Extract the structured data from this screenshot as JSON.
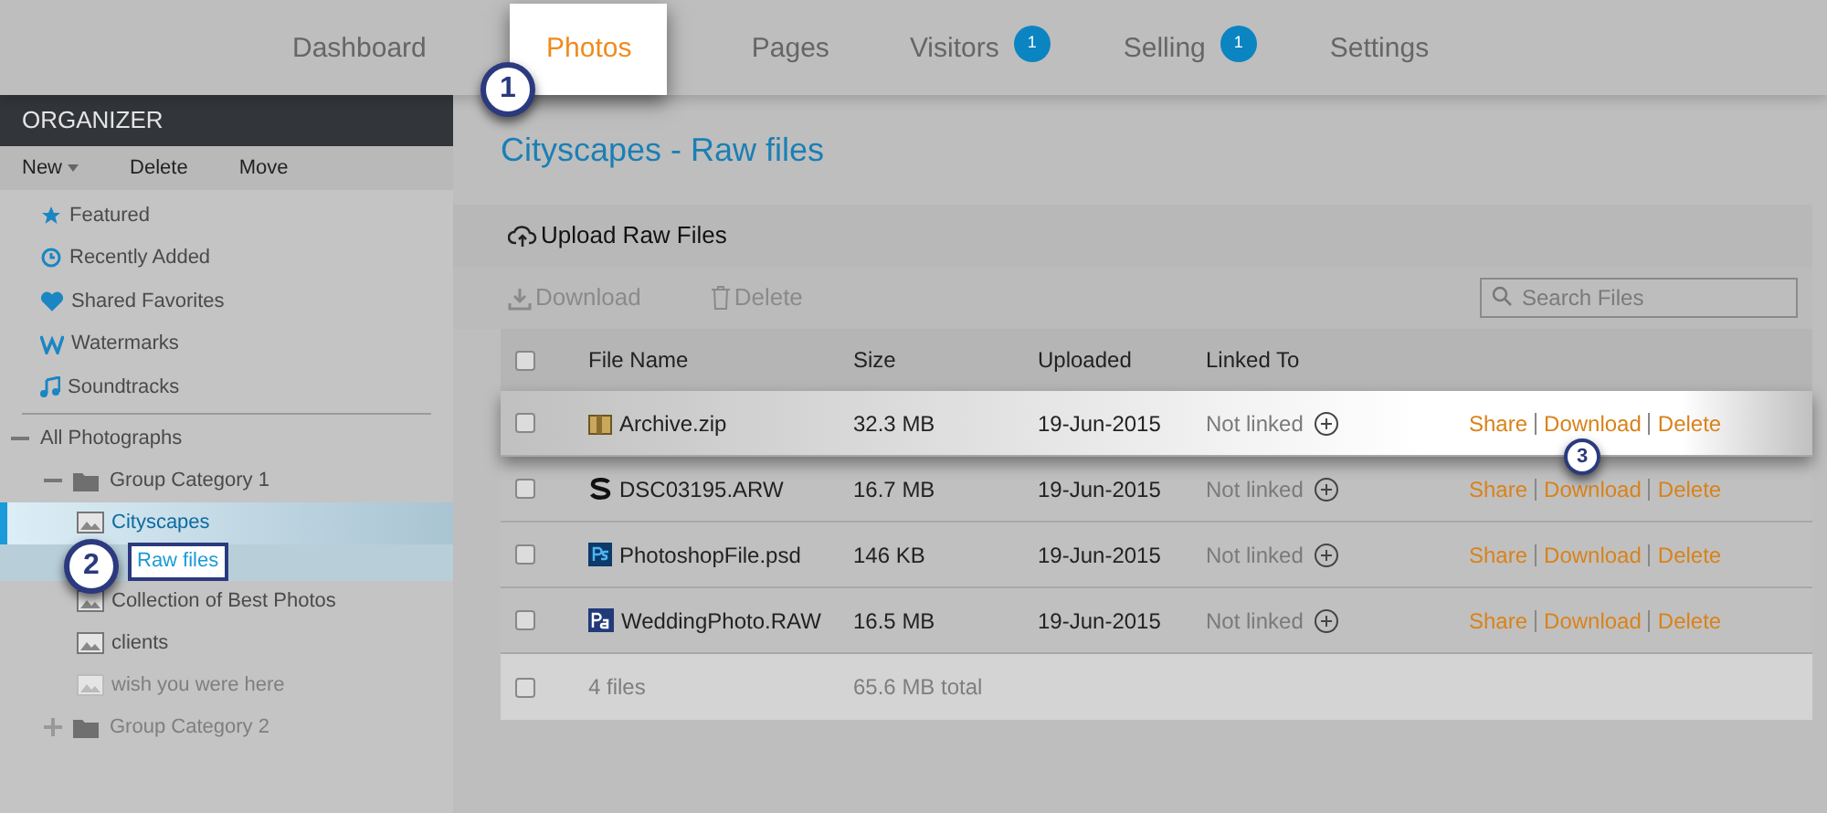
{
  "nav": {
    "tabs": [
      {
        "label": "Dashboard",
        "selected": false
      },
      {
        "label": "Photos",
        "selected": true
      },
      {
        "label": "Pages",
        "selected": false
      },
      {
        "label": "Visitors",
        "selected": false,
        "badge": "1"
      },
      {
        "label": "Selling",
        "selected": false,
        "badge": "1"
      },
      {
        "label": "Settings",
        "selected": false
      }
    ]
  },
  "sidebar": {
    "title": "ORGANIZER",
    "actions": [
      {
        "label": "New",
        "kind": "dropdown"
      },
      {
        "label": "Delete",
        "kind": "plain"
      },
      {
        "label": "Move",
        "kind": "plain"
      }
    ],
    "links": [
      {
        "label": "Featured"
      },
      {
        "label": "Recently Added"
      },
      {
        "label": "Shared Favorites"
      },
      {
        "label": "Watermarks"
      },
      {
        "label": "Soundtracks"
      }
    ],
    "tree": [
      {
        "label": "All Photographs",
        "kind": "root",
        "expanded": true,
        "children": [
          {
            "label": "Group Category 1",
            "kind": "folder",
            "expanded": true,
            "children": [
              {
                "label": "Cityscapes",
                "kind": "gallery",
                "selected": true,
                "children": [
                  {
                    "label": "Raw files",
                    "kind": "raw",
                    "selected": true
                  }
                ]
              },
              {
                "label": "Collection of Best Photos",
                "kind": "gallery",
                "selected": false
              },
              {
                "label": "clients",
                "kind": "gallery",
                "selected": false
              },
              {
                "label": "wish you were here",
                "kind": "gallery",
                "selected": false
              }
            ]
          },
          {
            "label": "Group Category 2",
            "kind": "folder",
            "expanded": false
          }
        ]
      }
    ]
  },
  "callouts": [
    "1",
    "2",
    "3"
  ],
  "main": {
    "title": "Cityscapes - Raw files",
    "upload": "Upload Raw Files",
    "toolbar": [
      {
        "label": "Download",
        "disabled": true
      },
      {
        "label": "Delete",
        "disabled": true
      }
    ],
    "search": {
      "placeholder": "Search Files"
    },
    "columns": [
      "File Name",
      "Size",
      "Uploaded",
      "Linked To"
    ],
    "select_all": {
      "checked": false
    },
    "rows": [
      {
        "name": "Archive.zip",
        "size": "32.3 MB",
        "uploaded": "19-Jun-2015",
        "linked": "Not linked",
        "highlighted": true,
        "checked": false,
        "actions": [
          "Share",
          "Download",
          "Delete"
        ]
      },
      {
        "name": "DSC03195.ARW",
        "size": "16.7 MB",
        "uploaded": "19-Jun-2015",
        "linked": "Not linked",
        "highlighted": false,
        "checked": false,
        "actions": [
          "Share",
          "Download",
          "Delete"
        ]
      },
      {
        "name": "PhotoshopFile.psd",
        "size": "146 KB",
        "uploaded": "19-Jun-2015",
        "linked": "Not linked",
        "highlighted": false,
        "checked": false,
        "actions": [
          "Share",
          "Download",
          "Delete"
        ]
      },
      {
        "name": "WeddingPhoto.RAW",
        "size": "16.5 MB",
        "uploaded": "19-Jun-2015",
        "linked": "Not linked",
        "highlighted": false,
        "checked": false,
        "actions": [
          "Share",
          "Download",
          "Delete"
        ]
      }
    ],
    "footer": {
      "count": "4 files",
      "total": "65.6 MB total",
      "checked": false
    }
  }
}
